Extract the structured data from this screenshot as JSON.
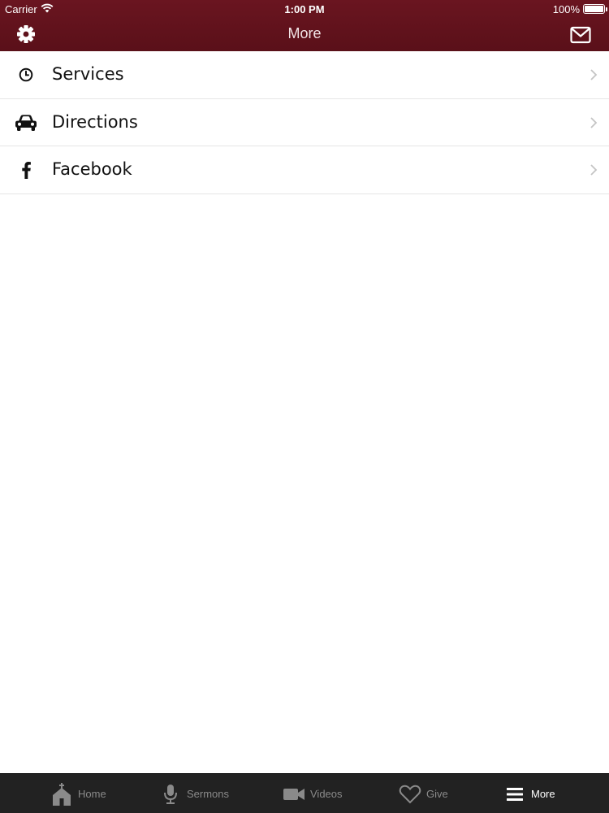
{
  "status_bar": {
    "carrier": "Carrier",
    "time": "1:00 PM",
    "battery": "100%"
  },
  "navbar": {
    "title": "More",
    "left_icon": "gear-icon",
    "right_icon": "mail-icon",
    "background_color": "#5e111b"
  },
  "menu": {
    "items": [
      {
        "label": "Services",
        "icon": "clock-icon"
      },
      {
        "label": "Directions",
        "icon": "car-icon"
      },
      {
        "label": "Facebook",
        "icon": "facebook-icon"
      }
    ]
  },
  "tabbar": {
    "background_color": "#222222",
    "active_tab": "More",
    "tabs": [
      {
        "label": "Home",
        "icon": "church-icon"
      },
      {
        "label": "Sermons",
        "icon": "microphone-icon"
      },
      {
        "label": "Videos",
        "icon": "video-camera-icon"
      },
      {
        "label": "Give",
        "icon": "heart-icon"
      },
      {
        "label": "More",
        "icon": "menu-icon"
      }
    ]
  }
}
